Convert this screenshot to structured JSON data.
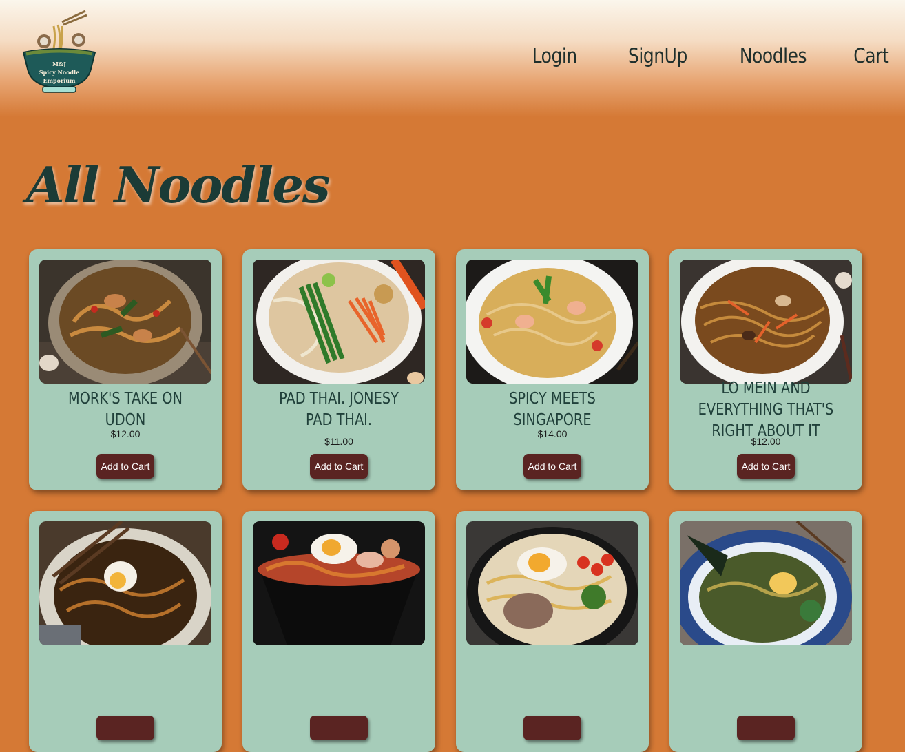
{
  "brand": {
    "logo_line1": "M&J",
    "logo_line2": "Spicy Noodle",
    "logo_line3": "Emporium",
    "icon": "noodle-bowl-logo"
  },
  "nav": {
    "login": "Login",
    "signup": "SignUp",
    "noodles": "Noodles",
    "cart": "Cart"
  },
  "page": {
    "title": "All Noodles"
  },
  "products": [
    {
      "name": "MORK'S TAKE ON UDON",
      "price": "$12.00",
      "button": "Add to Cart"
    },
    {
      "name": "PAD THAI. JONESY PAD THAI.",
      "price": "$11.00",
      "button": "Add to Cart"
    },
    {
      "name": "SPICY MEETS SINGAPORE",
      "price": "$14.00",
      "button": "Add to Cart"
    },
    {
      "name": "LO MEIN AND EVERYTHING THAT'S RIGHT ABOUT IT",
      "price": "$12.00",
      "button": "Add to Cart"
    },
    {
      "name": "",
      "price": "",
      "button": ""
    },
    {
      "name": "",
      "price": "",
      "button": ""
    },
    {
      "name": "",
      "price": "",
      "button": ""
    },
    {
      "name": "",
      "price": "",
      "button": ""
    }
  ],
  "colors": {
    "background": "#d57935",
    "card": "#a6ccb9",
    "title": "#1b3b36",
    "button": "#5a2422"
  }
}
